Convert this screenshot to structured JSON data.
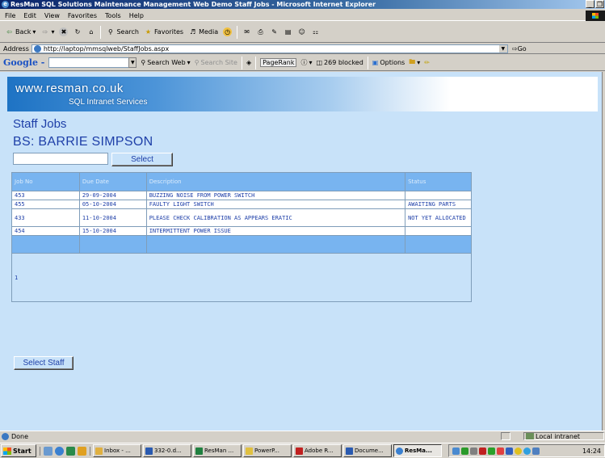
{
  "window": {
    "title": "ResMan SQL Solutions Maintenance Management Web Demo Staff Jobs - Microsoft Internet Explorer",
    "min_label": "_",
    "max_label": "❐"
  },
  "menu": [
    "File",
    "Edit",
    "View",
    "Favorites",
    "Tools",
    "Help"
  ],
  "toolbar": {
    "back_label": "Back",
    "search_label": "Search",
    "favorites_label": "Favorites",
    "media_label": "Media"
  },
  "address": {
    "label": "Address",
    "url": "http://laptop/mmsqlweb/StaffJobs.aspx",
    "go_label": "Go"
  },
  "google": {
    "logo": "Google -",
    "search_web_label": "Search Web",
    "search_site_label": "Search Site",
    "pagerank_label": "PageRank",
    "blocked_label": "269 blocked",
    "options_label": "Options"
  },
  "banner": {
    "line1": "www.resman.co.uk",
    "line2": "SQL Intranet Services"
  },
  "page": {
    "title": "Staff Jobs",
    "staff_name": "BS: BARRIE SIMPSON",
    "select_button": "Select",
    "staff_input_value": "",
    "select_staff_button": "Select Staff"
  },
  "jobs": {
    "headers": [
      "Job No",
      "Due Date",
      "Description",
      "Status"
    ],
    "rows": [
      {
        "job_no": "453",
        "due_date": "29-09-2004",
        "description": "BUZZING NOISE FROM POWER SWITCH",
        "status": ""
      },
      {
        "job_no": "455",
        "due_date": "05-10-2004",
        "description": "FAULTY LIGHT SWITCH",
        "status": "AWAITING PARTS"
      },
      {
        "job_no": "433",
        "due_date": "11-10-2004",
        "description": "PLEASE CHECK CALIBRATION AS APPEARS ERATIC",
        "status": "NOT YET ALLOCATED"
      },
      {
        "job_no": "454",
        "due_date": "15-10-2004",
        "description": "INTERMITTENT POWER ISSUE",
        "status": ""
      }
    ],
    "pager": "1"
  },
  "status": {
    "text": "Done",
    "zone": "Local intranet"
  },
  "taskbar": {
    "start_label": "Start",
    "tasks": [
      "Inbox - ...",
      "332-0.d...",
      "ResMan ...",
      "PowerP...",
      "Adobe R...",
      "Docume...",
      "ResMa..."
    ],
    "clock": "14:24"
  },
  "colors": {
    "page_bg": "#c8e2f9",
    "header_blue": "#78b4f0",
    "text_blue": "#1e3fa8"
  }
}
